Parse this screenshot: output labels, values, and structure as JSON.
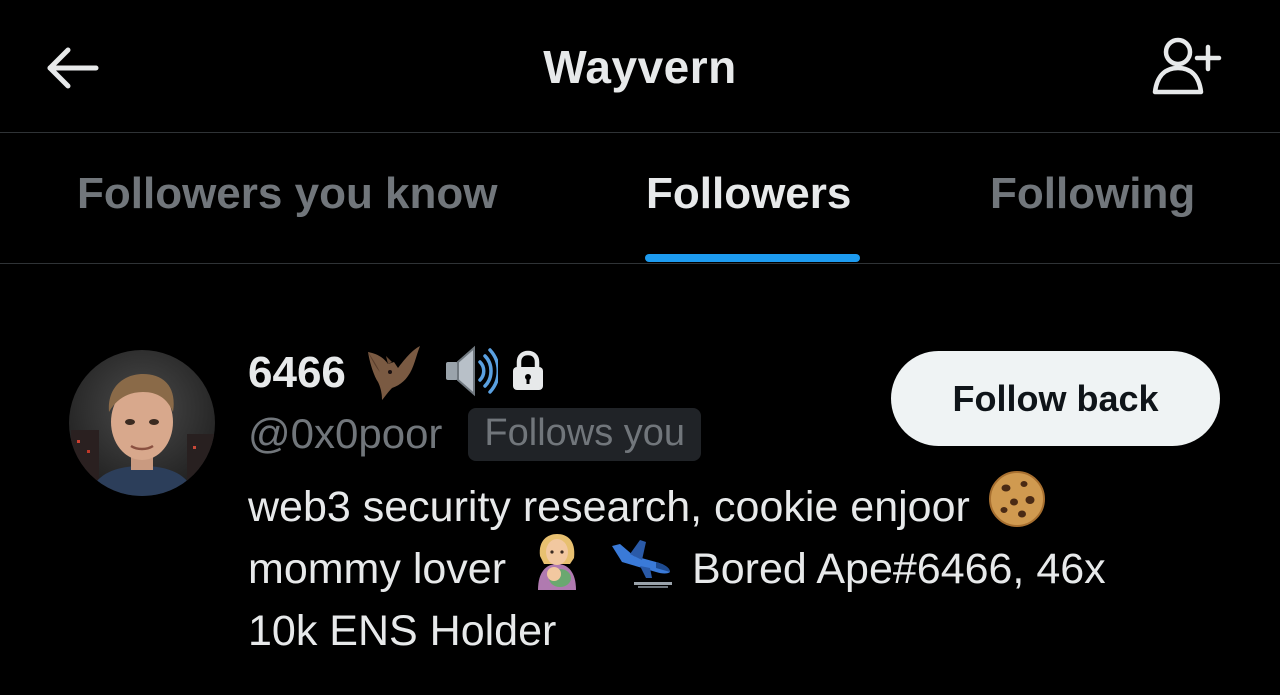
{
  "header": {
    "title": "Wayvern",
    "back_icon": "arrow-left-icon",
    "add_user_icon": "person-plus-icon"
  },
  "tabs": [
    {
      "label": "Followers you know",
      "active": false
    },
    {
      "label": "Followers",
      "active": true
    },
    {
      "label": "Following",
      "active": false
    }
  ],
  "user": {
    "display_name": "6466",
    "name_emojis": [
      "bat-emoji",
      "speaker-emoji"
    ],
    "protected_icon": "lock-icon",
    "handle": "@0x0poor",
    "follows_you_badge": "Follows you",
    "follow_back_label": "Follow back",
    "bio": {
      "line1_text": "web3 security research, cookie enjoor",
      "line1_emoji": "cookie-emoji",
      "line2_text_a": "mommy lover",
      "line2_emoji_a": "breastfeeding-emoji",
      "line2_emoji_b": "airplane-landing-emoji",
      "line2_text_b": "Bored Ape#6466, 46x",
      "line3_text": "10k ENS Holder"
    }
  },
  "colors": {
    "background": "#000000",
    "text_primary": "#e7e9ea",
    "text_secondary": "#71767b",
    "accent": "#1d9bf0",
    "divider": "#2f3336",
    "button_bg": "#eff3f4",
    "badge_bg": "#202327"
  }
}
